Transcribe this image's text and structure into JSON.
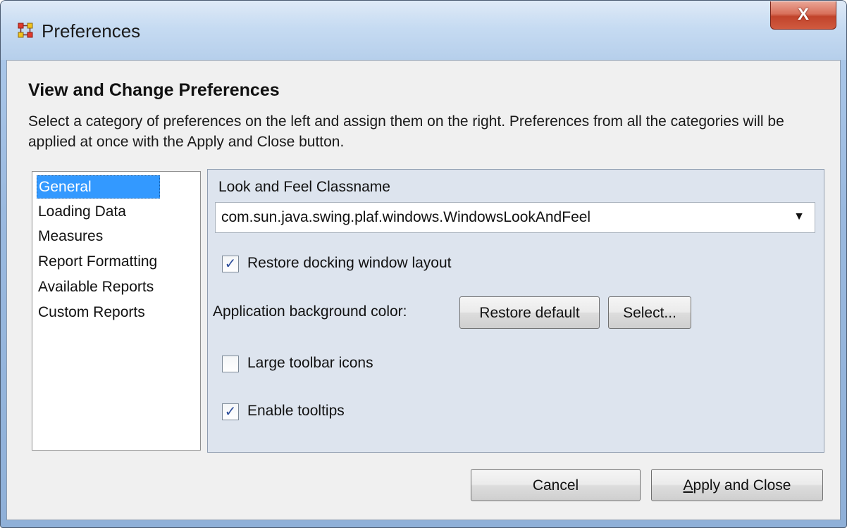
{
  "window": {
    "title": "Preferences",
    "close_label": "X"
  },
  "header": {
    "heading": "View and Change Preferences",
    "description": "Select a category of preferences on the left and assign them on the right. Preferences from all the categories will be applied at once with the Apply and Close button."
  },
  "categories": [
    {
      "label": "General",
      "selected": true
    },
    {
      "label": "Loading Data",
      "selected": false
    },
    {
      "label": "Measures",
      "selected": false
    },
    {
      "label": "Report Formatting",
      "selected": false
    },
    {
      "label": "Available Reports",
      "selected": false
    },
    {
      "label": "Custom Reports",
      "selected": false
    }
  ],
  "general": {
    "look_and_feel_label": "Look and Feel Classname",
    "look_and_feel_value": "com.sun.java.swing.plaf.windows.WindowsLookAndFeel",
    "restore_docking": {
      "label": "Restore docking window layout",
      "checked": true
    },
    "bg_color_label": "Application background color:",
    "restore_default_label": "Restore default",
    "select_label": "Select...",
    "large_icons": {
      "label": "Large toolbar icons",
      "checked": false
    },
    "enable_tooltips": {
      "label": "Enable tooltips",
      "checked": true
    }
  },
  "footer": {
    "cancel_label": "Cancel",
    "apply_label": "Apply and Close"
  },
  "colors": {
    "selection": "#3399ff",
    "panel_bg": "#dde4ee",
    "dialog_bg": "#f0f0f0",
    "close_button": "#c1432b"
  },
  "icons": {
    "app": "network-grid-icon",
    "close": "close-icon",
    "dropdown": "triangle-down-icon",
    "check": "checkmark-icon"
  }
}
